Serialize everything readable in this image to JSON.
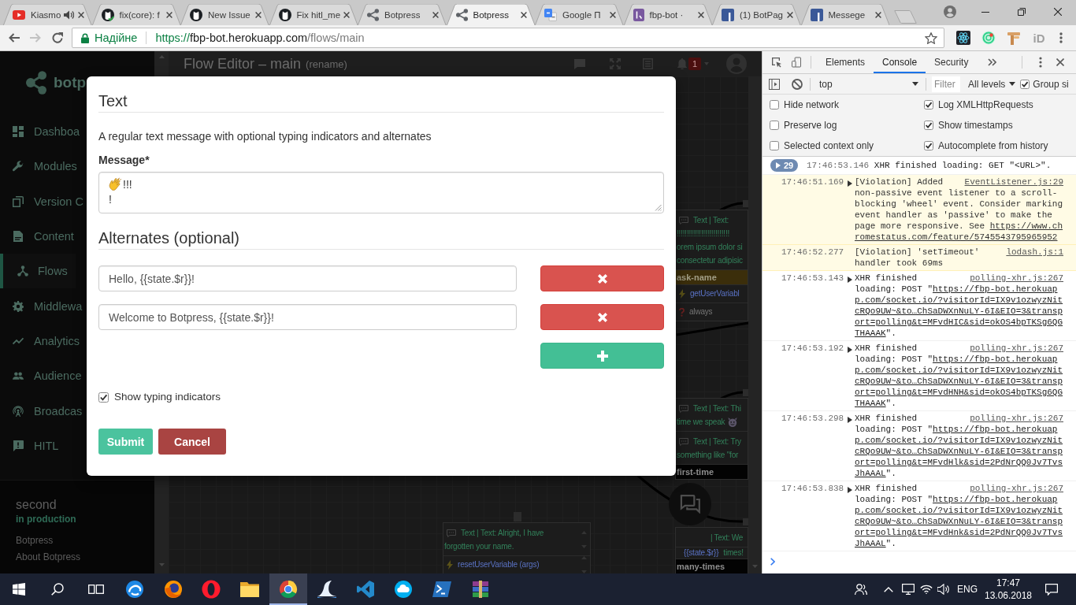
{
  "browser": {
    "tabs": [
      {
        "title": "Kiasmo",
        "kind": "play",
        "audio": true,
        "selected": false
      },
      {
        "title": "fix(core): f",
        "kind": "catcheck",
        "audio": false,
        "selected": false
      },
      {
        "title": "New Issue",
        "kind": "cat",
        "audio": false,
        "selected": false
      },
      {
        "title": "Fix hitl_me",
        "kind": "cat",
        "audio": false,
        "selected": false
      },
      {
        "title": "Botpress",
        "kind": "share",
        "audio": false,
        "selected": false
      },
      {
        "title": "Botpress",
        "kind": "share",
        "audio": false,
        "selected": true
      },
      {
        "title": "Google П",
        "kind": "tiles",
        "audio": false,
        "selected": false
      },
      {
        "title": "fbp-bot ·",
        "kind": "hook",
        "audio": false,
        "selected": false
      },
      {
        "title": "(1) BotPag",
        "kind": "tile",
        "audio": false,
        "selected": false
      },
      {
        "title": "Messege",
        "kind": "tile",
        "audio": false,
        "selected": false
      }
    ],
    "nav": [
      {
        "kind": "back",
        "disabled": false
      },
      {
        "kind": "forward",
        "disabled": true
      },
      {
        "kind": "reload",
        "disabled": false
      }
    ],
    "omnibox": {
      "security": "Надійне",
      "scheme": "https://",
      "host": "fbp-bot.herokuapp.com",
      "path": "/flows/main",
      "bookmarked": false
    },
    "extensions": [
      {
        "kind": "atom"
      },
      {
        "kind": "target"
      },
      {
        "kind": "signpost"
      },
      {
        "kind": "label",
        "label": "iD"
      }
    ]
  },
  "sidebar": {
    "logo": "botp",
    "items": [
      {
        "label": "Dashboa",
        "kind": "dashboard",
        "selected": false
      },
      {
        "label": "Modules",
        "kind": "wrench",
        "selected": false
      },
      {
        "label": "Version C",
        "kind": "copy",
        "selected": false
      },
      {
        "label": "Content",
        "kind": "file",
        "selected": false
      },
      {
        "label": "Flows",
        "kind": "fork",
        "selected": true
      },
      {
        "label": "Middlewa",
        "kind": "gear",
        "selected": false
      },
      {
        "label": "Analytics",
        "kind": "trend",
        "selected": false
      },
      {
        "label": "Audience",
        "kind": "people",
        "selected": false
      },
      {
        "label": "Broadcas",
        "kind": "antenna",
        "selected": false
      },
      {
        "label": "HITL",
        "kind": "alert",
        "selected": false
      }
    ],
    "bot": "second",
    "environment": "in production",
    "links": [
      "Botpress",
      "About Botpress"
    ]
  },
  "editor": {
    "title": "Flow Editor – main",
    "rename": "(rename)",
    "notifications": "1",
    "nodes": [
      {
        "rows": [
          {
            "kind": "say",
            "lines": [
              "Text | Text:",
              "!!!!!!!!!!!!!!!!!!!!!!!!!!",
              "orem ipsum dolor si",
              "consectetur adipisic"
            ]
          },
          {
            "kind": "name",
            "label": "ask-name",
            "color": "#3b2e0b"
          },
          {
            "kind": "action",
            "label": "getUserVariabl"
          },
          {
            "kind": "condition",
            "label": "always"
          }
        ]
      },
      {
        "rows": [
          {
            "kind": "say",
            "lines": [
              "Text | Text: Thi",
              "time we speak"
            ],
            "emoji": true
          },
          {
            "kind": "say",
            "lines": [
              "Text | Text: Try",
              "something like \"for"
            ]
          },
          {
            "kind": "name",
            "label": "first-time",
            "color": "#030303"
          }
        ]
      },
      {
        "sortable": true,
        "rows": [
          {
            "kind": "say",
            "lines": [
              "Text | Text: Alright, I have",
              "forgotten your name."
            ]
          },
          {
            "kind": "action",
            "label": "resetUserVariable (args)"
          }
        ]
      },
      {
        "rows": [
          {
            "kind": "text",
            "lines": [
              "| Text: We"
            ]
          },
          {
            "kind": "template",
            "variable": "{{state.$r}}",
            "text": "times!"
          },
          {
            "kind": "name",
            "label": "many-times",
            "color": "#030303"
          }
        ]
      }
    ]
  },
  "modal": {
    "title": "Text",
    "description": "A regular text message with optional typing indicators and alternates",
    "message": {
      "label": "Message*",
      "emoji": true,
      "value": "!!!\n!"
    },
    "alternates_title": "Alternates (optional)",
    "alternates": [
      "Hello, {{state.$r}}!",
      "Welcome to Botpress, {{state.$r}}!"
    ],
    "show_typing": {
      "label": "Show typing indicators",
      "checked": true
    },
    "buttons": [
      {
        "label": "Submit",
        "kind": "primary"
      },
      {
        "label": "Cancel",
        "kind": "danger"
      }
    ]
  },
  "devtools": {
    "tabs": [
      {
        "label": "Elements",
        "selected": false
      },
      {
        "label": "Console",
        "selected": true
      },
      {
        "label": "Security",
        "selected": false
      }
    ],
    "context": "top",
    "filter": {
      "placeholder": "Filter"
    },
    "levels": "All levels",
    "group_similar": {
      "label": "Group si",
      "checked": true
    },
    "settings": [
      {
        "label": "Hide network",
        "checked": false
      },
      {
        "label": "Log XMLHttpRequests",
        "checked": true
      },
      {
        "label": "Preserve log",
        "checked": false
      },
      {
        "label": "Show timestamps",
        "checked": true
      },
      {
        "label": "Selected context only",
        "checked": false
      },
      {
        "label": "Autocomplete from history",
        "checked": true
      }
    ],
    "messages": [
      {
        "kind": "group",
        "count": "29",
        "expanded": false,
        "time": "17:46:53.146",
        "text": "XHR finished loading: GET \"<URL>\"."
      },
      {
        "kind": "violation",
        "expanded": false,
        "time": "17:46:51.169",
        "text": "[Violation] Added",
        "source": "EventListener.js:29",
        "continuation": "non-passive event listener to a scroll-blocking 'wheel' event. Consider marking event handler as 'passive' to make the page more responsive. See ",
        "link": "https://www.chromestatus.com/feature/5745543795965952"
      },
      {
        "kind": "violation",
        "time": "17:46:52.277",
        "text": "[Violation] 'setTimeout'",
        "source": "lodash.js:1",
        "continuation": "handler took 69ms"
      },
      {
        "kind": "log",
        "expanded": false,
        "time": "17:46:53.143",
        "text": "XHR finished",
        "source": "polling-xhr.js:267",
        "continuation": "loading: POST \"",
        "link": "https://fbp-bot.herokuapp.com/socket.io/?visitorId=IX9v1ozwyzNitcRQo9UW~&to…ChSaDWXnNuLY-6I&EIO=3&transport=polling&t=MFvdHIC&sid=okOS4bpTKSg6QGTHAAAK",
        "after": "\"."
      },
      {
        "kind": "log",
        "expanded": false,
        "time": "17:46:53.192",
        "text": "XHR finished",
        "source": "polling-xhr.js:267",
        "continuation": "loading: POST \"",
        "link": "https://fbp-bot.herokuapp.com/socket.io/?visitorId=IX9v1ozwyzNitcRQo9UW~&to…ChSaDWXnNuLY-6I&EIO=3&transport=polling&t=MFvdHNH&sid=okOS4bpTKSg6QGTHAAAK",
        "after": "\"."
      },
      {
        "kind": "log",
        "expanded": false,
        "time": "17:46:53.298",
        "text": "XHR finished",
        "source": "polling-xhr.js:267",
        "continuation": "loading: POST \"",
        "link": "https://fbp-bot.herokuapp.com/socket.io/?visitorId=IX9v1ozwyzNitcRQo9UW~&to…ChSaDWXnNuLY-6I&EIO=3&transport=polling&t=MFvdHlk&sid=2PdNrQQ0Jv7TvsJhAAAL",
        "after": "\"."
      },
      {
        "kind": "log",
        "expanded": false,
        "time": "17:46:53.838",
        "text": "XHR finished",
        "source": "polling-xhr.js:267",
        "continuation": "loading: POST \"",
        "link": "https://fbp-bot.herokuapp.com/socket.io/?visitorId=IX9v1ozwyzNitcRQo9UW~&to…ChSaDWXnNuLY-6I&EIO=3&transport=polling&t=MFvdHnk&sid=2PdNrQQ0Jv7TvsJhAAAL",
        "after": "\"."
      }
    ]
  },
  "taskbar": {
    "apps": [
      {
        "kind": "swirl",
        "selected": false
      },
      {
        "kind": "orb",
        "selected": false
      },
      {
        "kind": "ring",
        "selected": false
      },
      {
        "kind": "folder",
        "selected": false
      },
      {
        "kind": "wheel",
        "selected": true
      },
      {
        "kind": "fin",
        "selected": false
      },
      {
        "kind": "ribbon",
        "selected": false
      },
      {
        "kind": "bubble",
        "selected": false
      },
      {
        "kind": "prompt",
        "selected": false
      },
      {
        "kind": "books",
        "selected": false
      }
    ],
    "language": "ENG",
    "time": "17:47",
    "date": "13.06.2018"
  }
}
